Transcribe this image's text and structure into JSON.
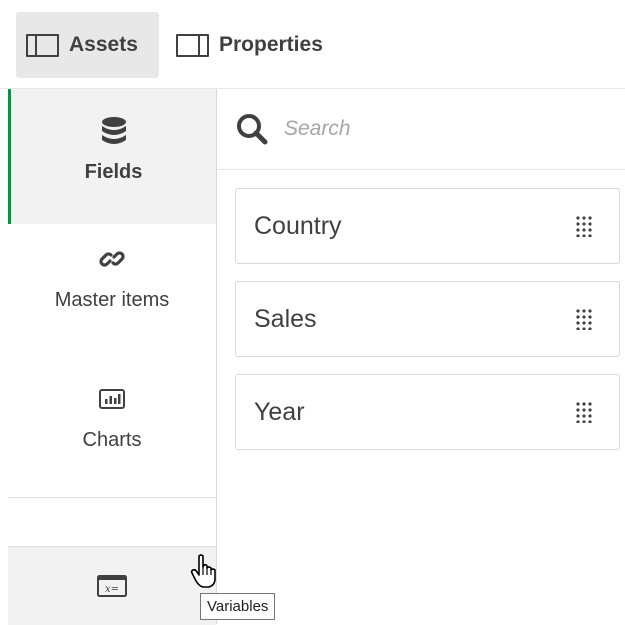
{
  "toolbar": {
    "assets_label": "Assets",
    "properties_label": "Properties"
  },
  "sidebar": {
    "items": [
      {
        "label": "Fields",
        "icon": "database-icon",
        "selected": true
      },
      {
        "label": "Master items",
        "icon": "link-icon",
        "selected": false
      },
      {
        "label": "Charts",
        "icon": "bar-chart-icon",
        "selected": false
      },
      {
        "label": "",
        "icon": "variables-icon",
        "selected": false
      }
    ],
    "accent_color": "#009845"
  },
  "search": {
    "placeholder": "Search",
    "value": ""
  },
  "fields": [
    {
      "name": "Country"
    },
    {
      "name": "Sales"
    },
    {
      "name": "Year"
    }
  ],
  "tooltip": {
    "text": "Variables"
  }
}
